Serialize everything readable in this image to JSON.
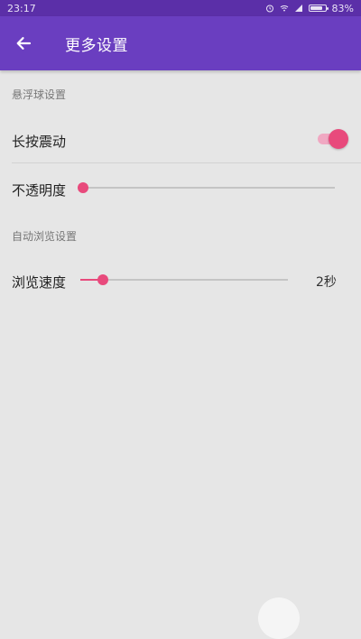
{
  "status_bar": {
    "time": "23:17",
    "battery": "83%"
  },
  "app_bar": {
    "title": "更多设置"
  },
  "sections": {
    "floating_ball": {
      "header": "悬浮球设置",
      "long_press_vibrate": {
        "label": "长按震动",
        "enabled": true
      },
      "opacity": {
        "label": "不透明度",
        "value_fraction": 0.0
      }
    },
    "auto_browse": {
      "header": "自动浏览设置",
      "speed": {
        "label": "浏览速度",
        "value_display": "2秒",
        "value_fraction": 0.11
      }
    }
  },
  "colors": {
    "status_bar": "#5b2fa8",
    "app_bar": "#6a3ec0",
    "accent": "#e84a7c",
    "background": "#e6e6e6"
  }
}
